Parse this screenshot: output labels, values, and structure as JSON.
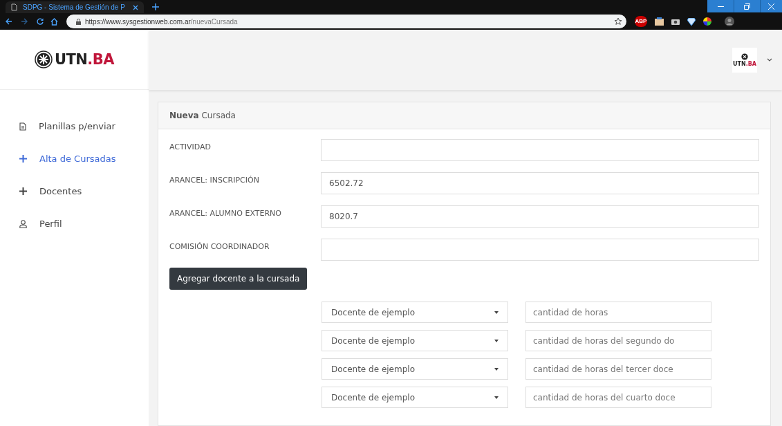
{
  "browser": {
    "tab_title": "SDPG - Sistema de Gestión de P",
    "url_host": "https://www.sysgestionweb.com.ar",
    "url_path": "/nuevaCursada",
    "extension_badge": "ABP"
  },
  "logo": {
    "brand": "UTN",
    "brand_accent": ".BA"
  },
  "header": {
    "avatar_brand": "UTN",
    "avatar_accent": ".BA"
  },
  "sidebar": {
    "items": [
      {
        "label": "Planillas p/enviar",
        "selected": false
      },
      {
        "label": "Alta de Cursadas",
        "selected": true
      },
      {
        "label": "Docentes",
        "selected": false
      },
      {
        "label": "Perfil",
        "selected": false
      }
    ]
  },
  "card": {
    "title": "**Nueva** Cursada",
    "fields": [
      {
        "label": "ACTIVIDAD"
      },
      {
        "label": "ARANCEL: INSCRIPCIÓN",
        "value": "6502.72"
      },
      {
        "label": "ARANCEL: ALUMNO EXTERNO",
        "value": "8020.7"
      },
      {
        "label": "COMISIÓN COORDINADOR"
      }
    ],
    "add_button": "Agregar docente a la cursada",
    "teachers": [
      {
        "docente": "Docente de ejemplo",
        "placeholder": "cantidad de horas"
      },
      {
        "docente": "Docente de ejemplo",
        "placeholder": "cantidad de horas del segundo do"
      },
      {
        "docente": "Docente de ejemplo",
        "placeholder": "cantidad de horas del tercer doce"
      },
      {
        "docente": "Docente de ejemplo",
        "placeholder": "cantidad de horas del cuarto doce"
      }
    ]
  }
}
